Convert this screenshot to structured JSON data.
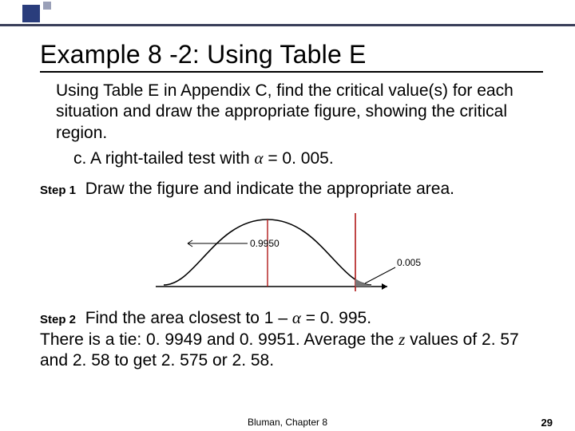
{
  "title": "Example 8 -2: Using Table E",
  "problem": "Using Table E in Appendix C, find the critical value(s) for each situation and draw the appropriate figure, showing the critical region.",
  "subpart_label": "c.",
  "subpart_text_1": "A right-tailed test with ",
  "alpha_sym": "α",
  "subpart_text_2": " = 0. 005.",
  "step1_label": "Step 1",
  "step1_text": "Draw the figure and indicate the appropriate area.",
  "step2_label": "Step 2",
  "step2_text_1a": "Find the area closest to 1 – ",
  "step2_text_1b": " = 0. 995.",
  "step2_text_2a": "There is a tie: 0. 9949 and 0. 9951.  Average the ",
  "z_sym": "z",
  "step2_text_2b": " values of 2. 57 and 2. 58 to get 2. 575 or 2. 58.",
  "figure": {
    "left_area_label": "0.9950",
    "right_area_label": "0.005"
  },
  "footer_chapter": "Bluman, Chapter 8",
  "footer_page": "29",
  "chart_data": {
    "type": "area",
    "title": "Standard normal curve with right-tailed critical region",
    "distribution": "standard_normal",
    "critical_value": 2.575,
    "tail": "right",
    "areas": {
      "left_of_critical": 0.995,
      "right_of_critical": 0.005
    },
    "xlabel": "",
    "ylabel": ""
  }
}
